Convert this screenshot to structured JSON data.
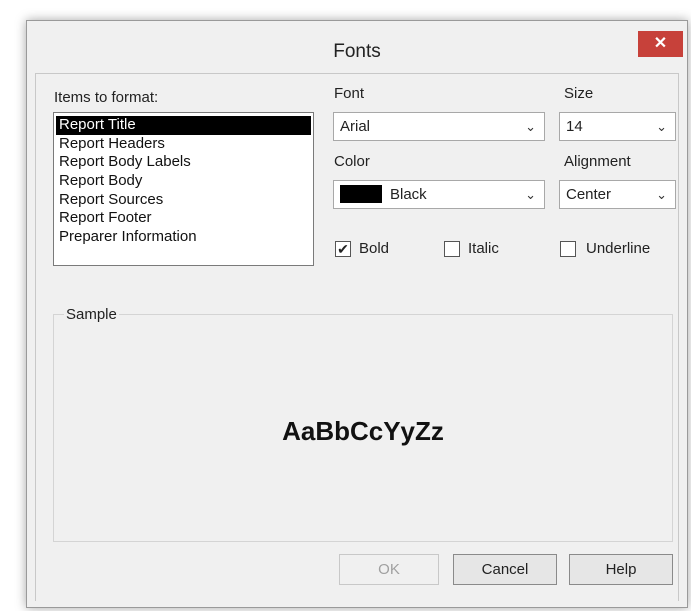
{
  "dialog": {
    "title": "Fonts",
    "close_label": "✕"
  },
  "items": {
    "label": "Items to format:",
    "list": [
      {
        "label": "Report Title",
        "selected": true
      },
      {
        "label": "Report Headers",
        "selected": false
      },
      {
        "label": "Report Body Labels",
        "selected": false
      },
      {
        "label": "Report Body",
        "selected": false
      },
      {
        "label": "Report Sources",
        "selected": false
      },
      {
        "label": "Report Footer",
        "selected": false
      },
      {
        "label": "Preparer Information",
        "selected": false
      }
    ]
  },
  "font": {
    "label": "Font",
    "value": "Arial"
  },
  "size": {
    "label": "Size",
    "value": "14"
  },
  "color": {
    "label": "Color",
    "value": "Black",
    "swatch": "#000000"
  },
  "alignment": {
    "label": "Alignment",
    "value": "Center"
  },
  "bold": {
    "label": "Bold",
    "checked": true
  },
  "italic": {
    "label": "Italic",
    "checked": false
  },
  "underline": {
    "label": "Underline",
    "checked": false
  },
  "sample": {
    "label": "Sample",
    "text": "AaBbCcYyZz"
  },
  "buttons": {
    "ok": "OK",
    "cancel": "Cancel",
    "help": "Help"
  },
  "colors": {
    "close_bg": "#c7413a",
    "selection_bg": "#000000",
    "dialog_bg": "#f0f0f0"
  }
}
